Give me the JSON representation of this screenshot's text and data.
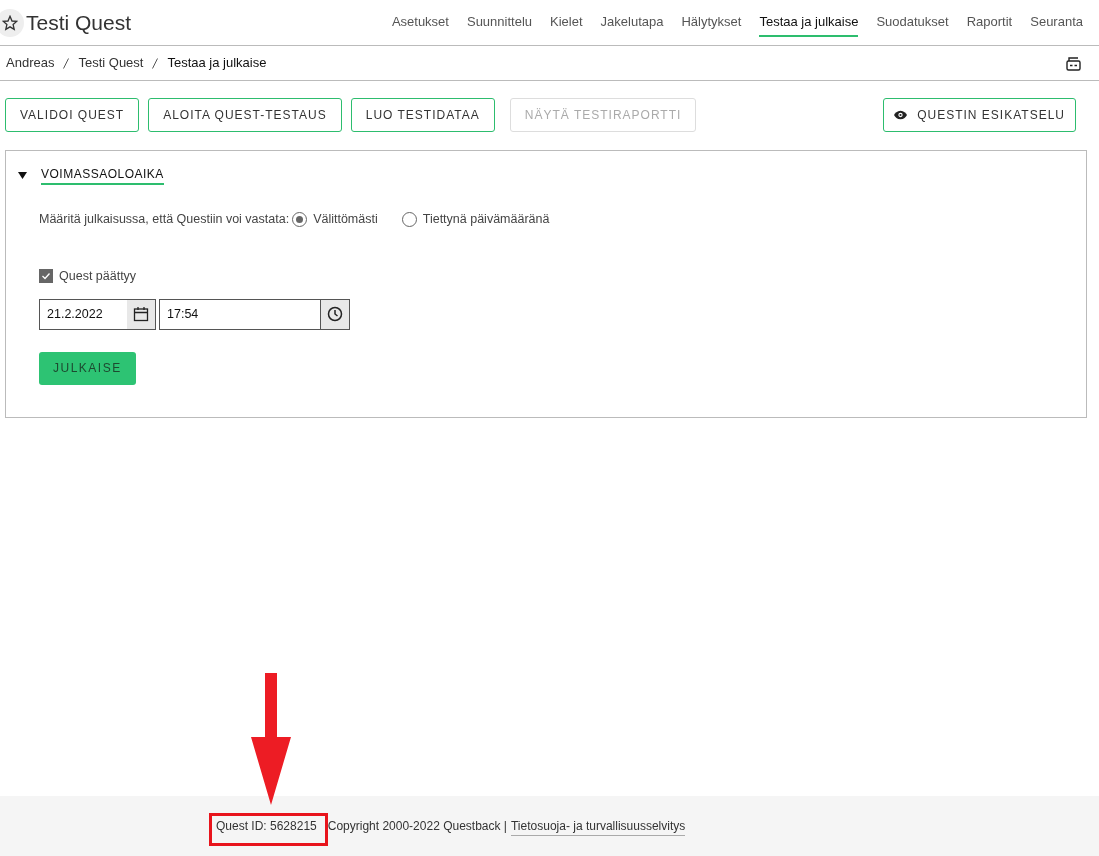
{
  "header": {
    "title": "Testi Quest",
    "favorite": false
  },
  "nav": [
    {
      "label": "Asetukset",
      "selected": false
    },
    {
      "label": "Suunnittelu",
      "selected": false
    },
    {
      "label": "Kielet",
      "selected": false
    },
    {
      "label": "Jakelutapa",
      "selected": false
    },
    {
      "label": "Hälytykset",
      "selected": false
    },
    {
      "label": "Testaa ja julkaise",
      "selected": true
    },
    {
      "label": "Suodatukset",
      "selected": false
    },
    {
      "label": "Raportit",
      "selected": false
    },
    {
      "label": "Seuranta",
      "selected": false
    }
  ],
  "breadcrumb": [
    "Andreas",
    "Testi Quest",
    "Testaa ja julkaise"
  ],
  "toolbar": [
    {
      "label": "VALIDOI QUEST",
      "disabled": false
    },
    {
      "label": "ALOITA QUEST-TESTAUS",
      "disabled": false
    },
    {
      "label": "LUO TESTIDATAA",
      "disabled": false
    },
    {
      "label": "NÄYTÄ TESTIRAPORTTI",
      "disabled": true
    }
  ],
  "preview_button": "QUESTIN ESIKATSELU",
  "section": {
    "title": "VOIMASSAOLOAIKA",
    "expanded": true,
    "prompt": "Määritä julkaisussa, että Questiin voi vastata:",
    "radios": [
      {
        "label": "Välittömästi",
        "selected": true
      },
      {
        "label": "Tiettynä päivämääränä",
        "selected": false
      }
    ],
    "end_checkbox": {
      "label": "Quest päättyy",
      "checked": true
    },
    "date": "21.2.2022",
    "time": "17:54",
    "publish_button": "JULKAISE"
  },
  "footer": {
    "quest_id": "Quest ID: 5628215",
    "copyright": "Copyright 2000-2022 Questback |",
    "link": "Tietosuoja- ja turvallisuusselvitys"
  }
}
